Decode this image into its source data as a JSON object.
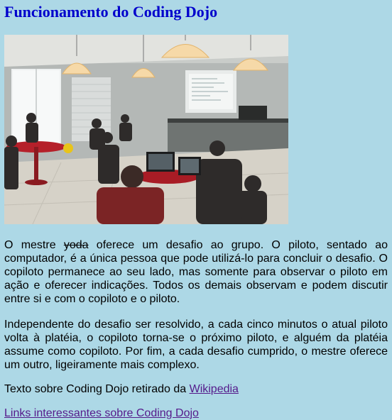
{
  "page": {
    "title": "Funcionamento do Coding Dojo",
    "paragraph1": {
      "before": "O mestre ",
      "struck": "yoda",
      "after": " oferece um desafio ao grupo. O piloto, sentado ao computador, é a única pessoa que pode utilizá-lo para concluir o desafio. O copiloto permanece ao seu lado, mas somente para observar o piloto em ação e oferecer indicações. Todos os demais observam e podem discutir entre si e com o copiloto e o piloto."
    },
    "paragraph2": "Independente do desafio ser resolvido, a cada cinco minutos o atual piloto volta à platéia, o copiloto torna-se o próximo piloto, e alguém da platéia assume como copiloto. Por fim, a cada desafio cumprido, o mestre oferece um outro, ligeiramente mais complexo.",
    "source_text": "Texto sobre Coding Dojo retirado da ",
    "source_link": "Wikipedia",
    "links_text": "Links interessantes sobre Coding Dojo"
  }
}
